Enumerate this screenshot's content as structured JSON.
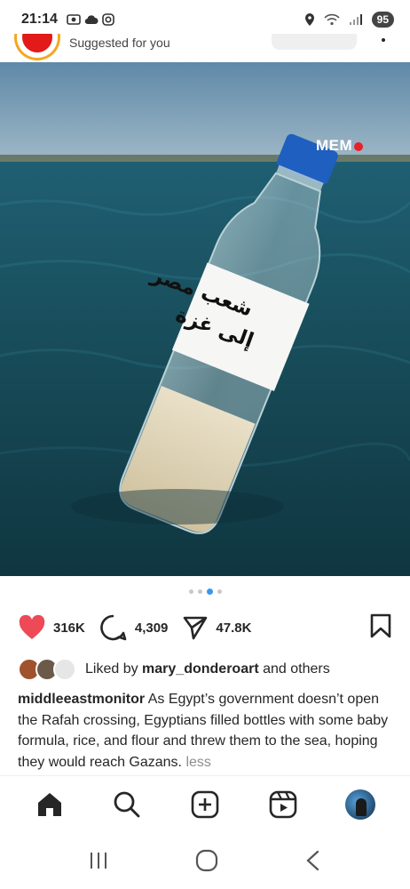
{
  "status_bar": {
    "time": "21:14",
    "battery": "95"
  },
  "post": {
    "header": {
      "label": "Suggested for you"
    },
    "image": {
      "watermark": "MEM",
      "bottle_label_line1": "شعب مصر",
      "bottle_label_line2": "إلى غزة"
    },
    "carousel": {
      "count": 4,
      "active_index": 2
    },
    "actions": {
      "likes": "316K",
      "comments": "4,309",
      "shares": "47.8K"
    },
    "liked_by": {
      "prefix": "Liked by ",
      "user": "mary_donderoart",
      "suffix": " and others"
    },
    "caption": {
      "username": "middleeastmonitor",
      "text": " As Egypt’s government doesn’t open the Rafah crossing, Egyptians filled bottles with some baby formula, rice, and flour and threw them to the sea, hoping they would reach Gazans.",
      "more_link": "less"
    }
  },
  "bottom_nav": {
    "items": [
      "home-icon",
      "search-icon",
      "create-icon",
      "reels-icon",
      "profile-avatar"
    ]
  },
  "system_nav": {
    "items": [
      "recents-icon",
      "home-circle-icon",
      "back-icon"
    ]
  },
  "colors": {
    "like_red": "#ed4956",
    "link_gray": "#8e8e8e",
    "active_dot": "#3897f0",
    "sea": "#1a4752",
    "bottle_cap": "#1f5fbf"
  }
}
